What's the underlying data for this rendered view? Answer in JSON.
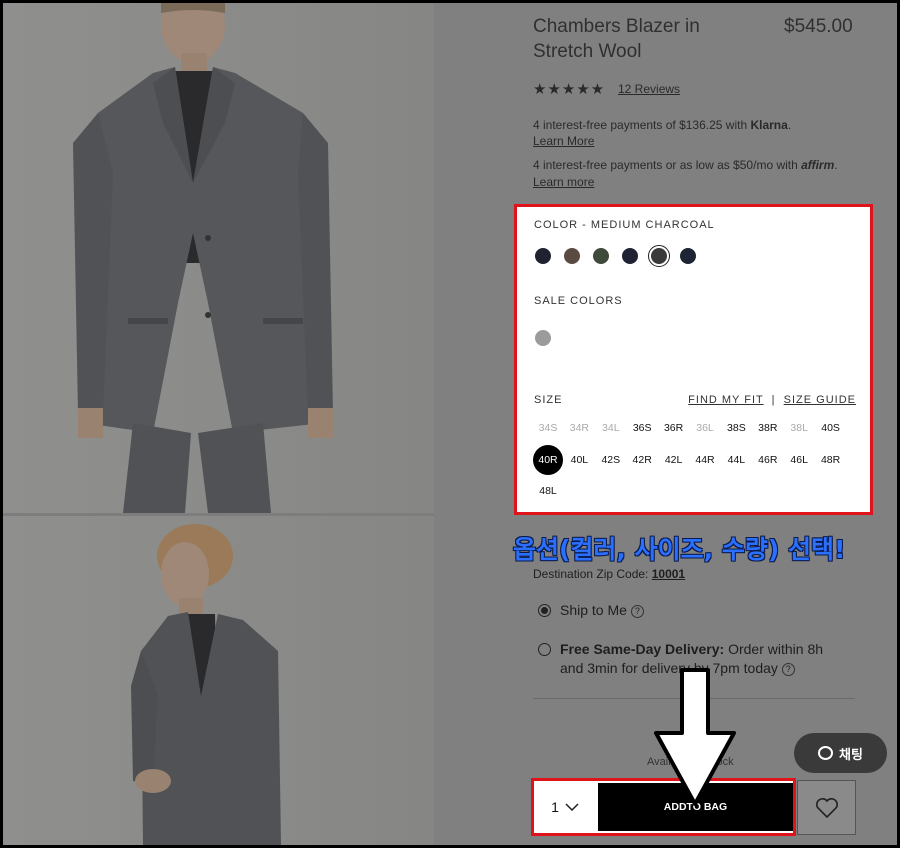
{
  "product": {
    "title": "Chambers Blazer in Stretch Wool",
    "price": "$545.00",
    "stars": "★★★★★",
    "reviews": "12 Reviews"
  },
  "payments": {
    "klarna_prefix": "4 interest-free payments of $136.25 with ",
    "klarna_brand": "Klarna",
    "klarna_suffix": ".",
    "klarna_learn": "Learn More",
    "affirm_prefix": "4 interest-free payments or as low as $50/mo with ",
    "affirm_brand": "affirm",
    "affirm_suffix": ".",
    "affirm_learn": "Learn more"
  },
  "options": {
    "color_label": "COLOR - MEDIUM CHARCOAL",
    "colors": [
      "#1f2330",
      "#5a4a42",
      "#3f4a3a",
      "#1e2233",
      "#3a3a3a",
      "#1d2535"
    ],
    "selected_color_index": 4,
    "sale_label": "SALE COLORS",
    "sale_colors": [
      "#9b9b9b"
    ],
    "size_label": "SIZE",
    "find_my_fit": "FIND MY FIT",
    "separator": "|",
    "size_guide": "SIZE GUIDE",
    "sizes": [
      {
        "label": "34S",
        "oos": true
      },
      {
        "label": "34R",
        "oos": true
      },
      {
        "label": "34L",
        "oos": true
      },
      {
        "label": "36S",
        "oos": false
      },
      {
        "label": "36R",
        "oos": false
      },
      {
        "label": "36L",
        "oos": true
      },
      {
        "label": "38S",
        "oos": false
      },
      {
        "label": "38R",
        "oos": false
      },
      {
        "label": "38L",
        "oos": true
      },
      {
        "label": "40S",
        "oos": false
      },
      {
        "label": "40R",
        "oos": false,
        "selected": true
      },
      {
        "label": "40L",
        "oos": false
      },
      {
        "label": "42S",
        "oos": false
      },
      {
        "label": "42R",
        "oos": false
      },
      {
        "label": "42L",
        "oos": false
      },
      {
        "label": "44R",
        "oos": false
      },
      {
        "label": "44L",
        "oos": false
      },
      {
        "label": "46R",
        "oos": false
      },
      {
        "label": "46L",
        "oos": false
      },
      {
        "label": "48R",
        "oos": false
      },
      {
        "label": "48L",
        "oos": false
      }
    ]
  },
  "annotation": "옵션(컬러, 사이즈, 수량) 선택!",
  "shipping": {
    "zip_label": "Destination Zip Code: ",
    "zip_code": "10001",
    "ship_to_me": "Ship to Me",
    "same_day_bold": "Free Same-Day Delivery:",
    "same_day_rest": " Order within 8h and 3min for delivery by 7pm today"
  },
  "availability": "Available in Stock",
  "chat_label": "채팅",
  "purchase": {
    "quantity": "1",
    "add_to_bag": "ADDTO BAG"
  },
  "colors": {
    "highlight": "#e0131a",
    "annotation_text": "#2b6fff"
  }
}
